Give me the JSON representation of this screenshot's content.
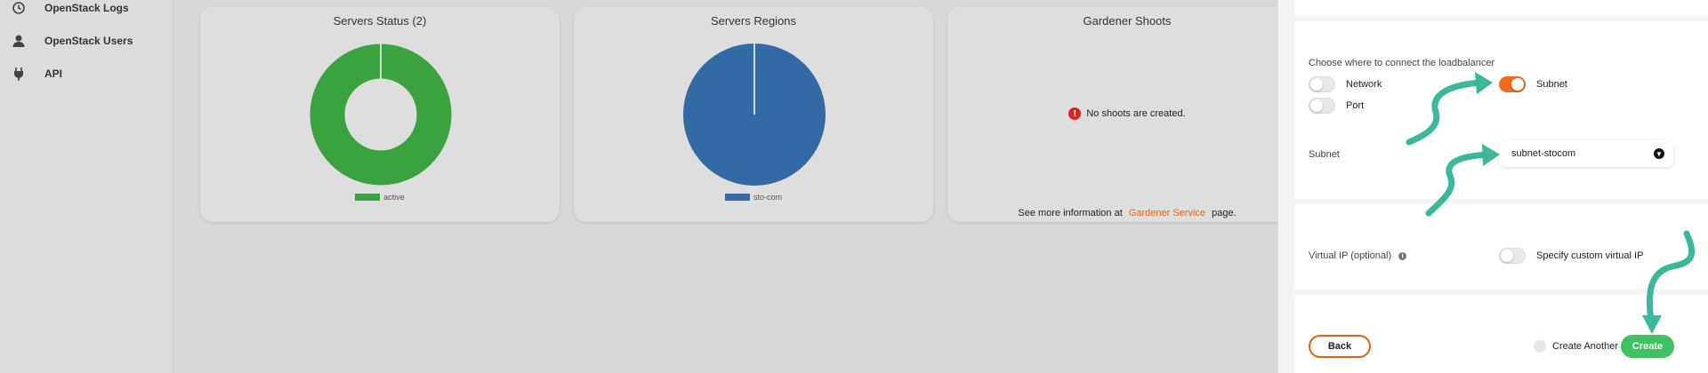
{
  "sidebar": {
    "items": [
      {
        "label": "OpenStack Logs",
        "icon": "history-icon"
      },
      {
        "label": "OpenStack Users",
        "icon": "user-icon"
      },
      {
        "label": "API",
        "icon": "plug-icon"
      }
    ]
  },
  "cards": {
    "servers_status": {
      "title": "Servers Status (2)",
      "legend": "active",
      "color": "#3aa33f"
    },
    "servers_regions": {
      "title": "Servers Regions",
      "legend": "sto-com",
      "color": "#3369a4"
    },
    "gardener": {
      "title": "Gardener Shoots",
      "message": "No shoots are created.",
      "more_prefix": "See more information at",
      "more_link": "Gardener Service",
      "more_suffix": "page."
    }
  },
  "chart_data": [
    {
      "type": "pie",
      "title": "Servers Status (2)",
      "categories": [
        "active"
      ],
      "values": [
        2
      ],
      "legend_position": "bottom",
      "style": "donut"
    },
    {
      "type": "pie",
      "title": "Servers Regions",
      "categories": [
        "sto-com"
      ],
      "values": [
        2
      ],
      "legend_position": "bottom"
    }
  ],
  "panel": {
    "connect_label": "Choose where to connect the loadbalancer",
    "options": [
      {
        "label": "Network",
        "on": false
      },
      {
        "label": "Subnet",
        "on": true
      },
      {
        "label": "Port",
        "on": false
      }
    ],
    "subnet_label": "Subnet",
    "subnet_value": "subnet-stocom",
    "vip_label": "Virtual IP (optional)",
    "vip_toggle_label": "Specify custom virtual IP",
    "back_label": "Back",
    "create_another_label": "Create Another",
    "create_label": "Create"
  },
  "colors": {
    "accent": "#f06a1f",
    "create": "#3fc262",
    "annotation_arrow": "#3bb89a"
  }
}
